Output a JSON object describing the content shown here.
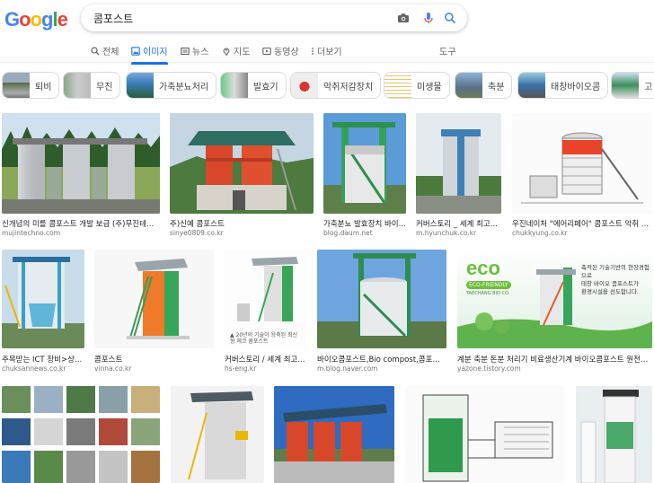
{
  "logo": {
    "letters": [
      "G",
      "o",
      "o",
      "g",
      "l",
      "e"
    ],
    "colors": [
      "#4285F4",
      "#EA4335",
      "#FBBC05",
      "#4285F4",
      "#34A853",
      "#EA4335"
    ]
  },
  "search": {
    "query": "콤포스트"
  },
  "tabs": {
    "all": "전체",
    "images": "이미지",
    "news": "뉴스",
    "maps": "지도",
    "videos": "동영상",
    "more": "더보기",
    "tools": "도구"
  },
  "chips": [
    "퇴비",
    "무진",
    "가축분뇨처리",
    "발효기",
    "악취저감장치",
    "미생물",
    "축분",
    "태창바이오콤",
    "고"
  ],
  "results": [
    {
      "title": "신개념의 미를 콤포스트 개발 보급 (주)무진테크 ...",
      "source": "mujintechno.com"
    },
    {
      "title": "주)신예 콤포스트",
      "source": "sinye0809.co.kr"
    },
    {
      "title": "가축분뇨 발효장치 바이...",
      "source": "blog.daum.net"
    },
    {
      "title": "커버스토리 _ 세계 최고...",
      "source": "m.hyunchuk.co.kr"
    },
    {
      "title": "우진네이처 \"에어리페어\" 콤포스트 악취 저...",
      "source": "chukkyung.co.kr"
    },
    {
      "title": "주목받는 ICT 장비>상일...",
      "source": "chuksannews.co.kr"
    },
    {
      "title": "콤포스트",
      "source": "vinna.co.kr"
    },
    {
      "title": "커버스토리 / 세계 최고...",
      "source": "hs-eng.kr"
    },
    {
      "title": "바이오콤포스트,Bio compost,콤포스트,...",
      "source": "m.blog.naver.com"
    },
    {
      "title": "계분 축분 돈분 처리기 비료생산기계 바이오콤포스트 원전기...",
      "source": "yazone.tistory.com"
    }
  ],
  "overlay_texts": {
    "r7_caption": "▲ 20년의 기술이 응축된 최신형 에코 콤포스트",
    "r10_brand": "eco",
    "r10_sub": "ECO-FRIENDLY",
    "r10_company": "TAECHANG BIO CO.",
    "r10_line1": "축적된 기술기반의 현장경험으로",
    "r10_line2": "태창 바이오 콤포스트가",
    "r10_line3": "환경시설을 선도합니다."
  }
}
